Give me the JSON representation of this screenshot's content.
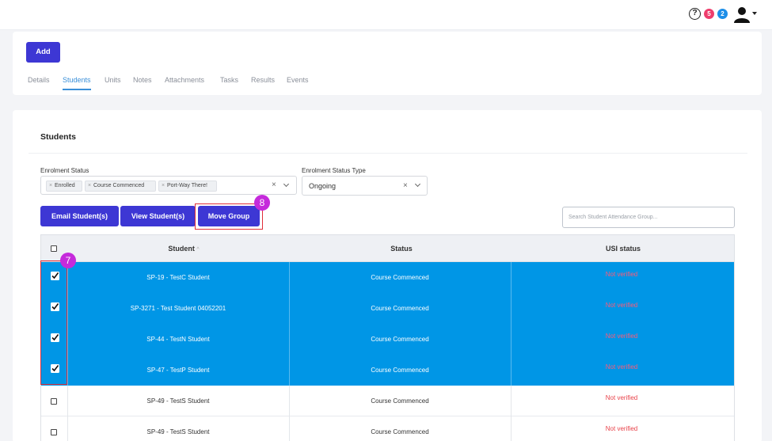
{
  "header": {
    "help_icon": "?",
    "notifications_count": "5",
    "messages_count": "2"
  },
  "top_card": {
    "add_label": "Add",
    "tabs": [
      {
        "label": "Details",
        "active": false
      },
      {
        "label": "Students",
        "active": true
      },
      {
        "label": "Units",
        "active": false
      },
      {
        "label": "Notes",
        "active": false
      },
      {
        "label": "Attachments",
        "active": false
      },
      {
        "label": "Tasks",
        "active": false
      },
      {
        "label": "Results",
        "active": false
      },
      {
        "label": "Events",
        "active": false
      }
    ]
  },
  "students_section": {
    "title": "Students",
    "enrolment_status": {
      "label": "Enrolment Status",
      "chips": [
        "Enrolled",
        "Course Commenced",
        "Port-Way There!"
      ]
    },
    "enrolment_status_type": {
      "label": "Enrolment Status Type",
      "value": "Ongoing"
    },
    "buttons": {
      "email": "Email Student(s)",
      "view": "View Student(s)",
      "move": "Move Group"
    },
    "search_placeholder": "Search Student Attendance Group...",
    "annotations": {
      "move_step": "8",
      "checkbox_step": "7"
    },
    "table": {
      "headers": {
        "student": "Student",
        "sort_icon": "^",
        "status": "Status",
        "usi": "USI status"
      },
      "rows": [
        {
          "student": "SP-19 - TestC Student",
          "status": "Course Commenced",
          "usi": "Not verified",
          "selected": true
        },
        {
          "student": "SP-3271 - Test Student 04052201",
          "status": "Course Commenced",
          "usi": "Not verified",
          "selected": true
        },
        {
          "student": "SP-44 - TestN Student",
          "status": "Course Commenced",
          "usi": "Not verified",
          "selected": true
        },
        {
          "student": "SP-47 - TestP Student",
          "status": "Course Commenced",
          "usi": "Not verified",
          "selected": true
        },
        {
          "student": "SP-49 - TestS Student",
          "status": "Course Commenced",
          "usi": "Not verified",
          "selected": false
        },
        {
          "student": "SP-49 - TestS Student",
          "status": "Course Commenced",
          "usi": "Not verified",
          "selected": false
        }
      ]
    }
  },
  "colors": {
    "primary": "#3d37d4",
    "selected_row": "#0096e6",
    "not_verified": "#e8424a",
    "highlight_box": "#e02f3a",
    "step_badge": "#c52adb"
  }
}
